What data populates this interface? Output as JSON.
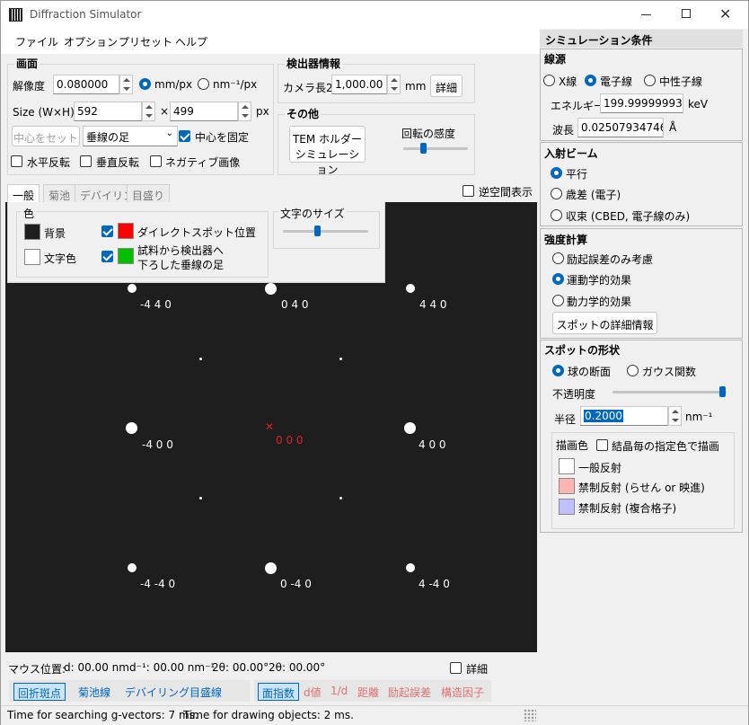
{
  "app": {
    "title": "Diffraction Simulator"
  },
  "menu": {
    "file": "ファイル",
    "option": "オプション",
    "preset": "プリセット",
    "help": "ヘルプ"
  },
  "screen": {
    "title": "画面",
    "resolution_label": "解像度",
    "resolution_value": "0.080000",
    "unit_mm": "mm/px",
    "unit_nm": "nm⁻¹/px",
    "size_label": "Size (W×H)",
    "width": "592",
    "times": "×",
    "height": "499",
    "px": "px",
    "set_center": "中心をセット",
    "foot_select": "垂線の足",
    "fix_center": "中心を固定",
    "flip_h": "水平反転",
    "flip_v": "垂直反転",
    "negative": "ネガティブ画像"
  },
  "detector": {
    "title": "検出器情報",
    "camera_label": "カメラ長2",
    "camera_value": "1,000.00",
    "mm": "mm",
    "detail": "詳細"
  },
  "other": {
    "title": "その他",
    "tem_button_line1": "TEM ホルダー",
    "tem_button_line2": "シミュレーション",
    "rotation_label": "回転の感度"
  },
  "tabs": {
    "general": "一般",
    "kikuchi": "菊池",
    "debye": "デバイリン",
    "scale": "目盛り",
    "reciprocal": "逆空間表示"
  },
  "general_panel": {
    "color_title": "色",
    "background": "背景",
    "text_color": "文字色",
    "direct_spot": "ダイレクトスポット位置",
    "foot_line1": "試料から検出器へ",
    "foot_line2": "下ろした垂線の足",
    "font_size_title": "文字のサイズ"
  },
  "spots": [
    {
      "label": "-4 4 0"
    },
    {
      "label": "0 4 0"
    },
    {
      "label": "4 4 0"
    },
    {
      "label": "-4 0 0"
    },
    {
      "label": "0 0 0"
    },
    {
      "label": "4 0 0"
    },
    {
      "label": "-4 -4 0"
    },
    {
      "label": "0 -4 0"
    },
    {
      "label": "4 -4 0"
    }
  ],
  "colors": {
    "direct_spot": "#ff0000",
    "foot": "#00c000",
    "background": "#1e1e1e",
    "text": "#ffffff",
    "accent": "#0067c0",
    "origin_label": "#e02020"
  },
  "mouse": {
    "label": "マウス位置:",
    "d": "d: 00.00 nm",
    "dinv": "d⁻¹: 00.00 nm⁻¹",
    "two_theta1": "2θ: 00.00°",
    "two_theta2": "2θ: 00.00°",
    "detail": "詳細"
  },
  "bottom_toggles": {
    "spots": "回折斑点",
    "kikuchi": "菊池線",
    "debye": "デバイリング",
    "scale": "目盛線",
    "indices": "面指数",
    "dvalue": "d値",
    "inv_d": "1/d",
    "distance": "距離",
    "excitation": "励起誤差",
    "structure": "構造因子"
  },
  "status": {
    "g_vectors": "Time for searching g-vectors: 7 ms.",
    "drawing": "Time for drawing objects: 2 ms."
  },
  "sim": {
    "title": "シミュレーション条件",
    "source_title": "線源",
    "xray": "X線",
    "electron": "電子線",
    "neutron": "中性子線",
    "energy_label": "エネルギー",
    "energy_value": "199.99999993",
    "kev": "keV",
    "wavelength_label": "波長",
    "wavelength_value": "0.02507934746",
    "angstrom": "Å"
  },
  "beam": {
    "title": "入射ビーム",
    "parallel": "平行",
    "precession": "歳差 (電子)",
    "convergent": "収束 (CBED, 電子線のみ)"
  },
  "intensity": {
    "title": "強度計算",
    "excitation_only": "励起誤差のみ考慮",
    "kinematic": "運動学的効果",
    "dynamic": "動力学的効果",
    "spot_detail": "スポットの詳細情報"
  },
  "shape": {
    "title": "スポットの形状",
    "sphere": "球の断面",
    "gauss": "ガウス関数",
    "opacity": "不透明度",
    "radius_label": "半径",
    "radius_value": "0.2000",
    "radius_unit": "nm⁻¹",
    "draw_color": "描画色",
    "per_crystal": "結晶毎の指定色で描画",
    "general": "一般反射",
    "forbidden_screw": "禁制反射 (らせん or 映進)",
    "forbidden_complex": "禁制反射 (複合格子)"
  }
}
